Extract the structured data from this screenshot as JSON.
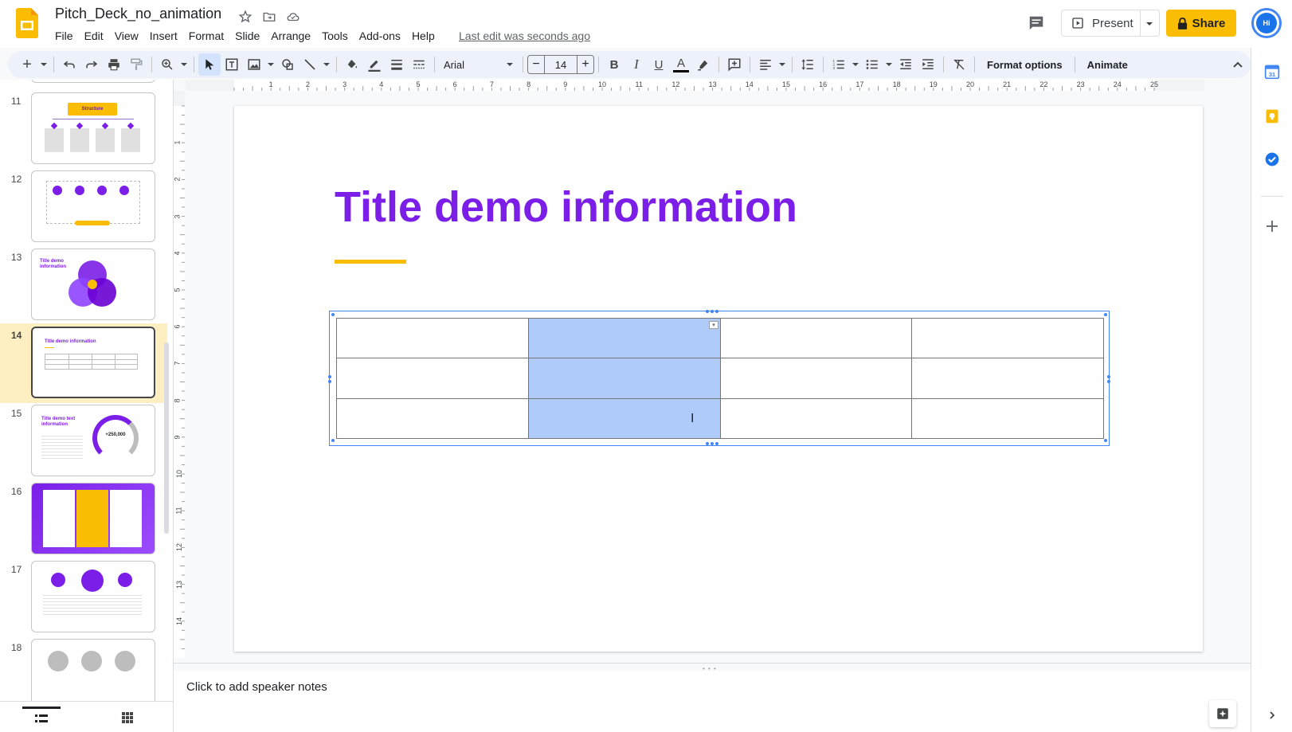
{
  "document": {
    "title": "Pitch_Deck_no_animation",
    "last_edit": "Last edit was seconds ago"
  },
  "menu": [
    "File",
    "Edit",
    "View",
    "Insert",
    "Format",
    "Slide",
    "Arrange",
    "Tools",
    "Add-ons",
    "Help"
  ],
  "header": {
    "present_label": "Present",
    "share_label": "Share",
    "avatar_initials": "Hi"
  },
  "toolbar": {
    "font_name": "Arial",
    "font_size": "14",
    "format_options_label": "Format options",
    "animate_label": "Animate"
  },
  "filmstrip": {
    "slides": [
      {
        "number": "11",
        "title": "Structure"
      },
      {
        "number": "12",
        "title": ""
      },
      {
        "number": "13",
        "title": "Title demo information"
      },
      {
        "number": "14",
        "title": "Title demo information"
      },
      {
        "number": "15",
        "title": "Title demo text information",
        "stat": "+250,000"
      },
      {
        "number": "16",
        "title": ""
      },
      {
        "number": "17",
        "title": ""
      },
      {
        "number": "18",
        "title": ""
      }
    ],
    "active_slide": "14"
  },
  "ruler": {
    "horizontal": [
      "1",
      "2",
      "3",
      "4",
      "5",
      "6",
      "7",
      "8",
      "9",
      "10",
      "11",
      "12",
      "13",
      "14",
      "15",
      "16",
      "17",
      "18",
      "19",
      "20",
      "21",
      "22",
      "23",
      "24",
      "25"
    ],
    "vertical": [
      "1",
      "2",
      "3",
      "4",
      "5",
      "6",
      "7",
      "8",
      "9",
      "10",
      "11",
      "12",
      "13",
      "14"
    ]
  },
  "slide": {
    "title": "Title demo information",
    "title_color": "#7b1fe8",
    "accent_color": "#fbbc04",
    "table": {
      "rows": 3,
      "cols": 4,
      "selected_col": 2
    }
  },
  "notes": {
    "placeholder": "Click to add speaker notes"
  },
  "colors": {
    "share_button": "#fbbc04",
    "selection": "#aecbfa",
    "brand_purple": "#7b1fe8"
  }
}
